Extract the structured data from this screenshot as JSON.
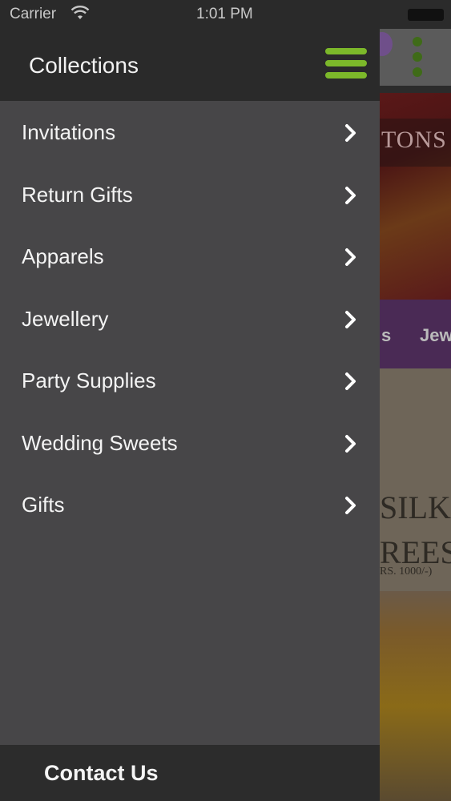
{
  "status_bar": {
    "carrier": "Carrier",
    "time": "1:01 PM"
  },
  "background": {
    "banner_text": "TONS",
    "tabs": [
      "s",
      "Jew"
    ],
    "promo_line1": "SILK",
    "promo_line2": "REES",
    "promo_price": "RS. 1000/-)"
  },
  "drawer": {
    "title": "Collections",
    "items": [
      {
        "label": "Invitations"
      },
      {
        "label": "Return Gifts"
      },
      {
        "label": "Apparels"
      },
      {
        "label": "Jewellery"
      },
      {
        "label": "Party Supplies"
      },
      {
        "label": "Wedding Sweets"
      },
      {
        "label": "Gifts"
      }
    ],
    "footer_label": "Contact Us"
  },
  "colors": {
    "accent_green": "#7cb82a",
    "drawer_bg": "#474648",
    "header_bg": "#2a2a2a"
  },
  "icons": {
    "menu": "hamburger-icon",
    "item_arrow": "chevron-right-icon",
    "overflow": "more-vertical-icon",
    "wifi": "wifi-icon",
    "battery": "battery-icon"
  }
}
